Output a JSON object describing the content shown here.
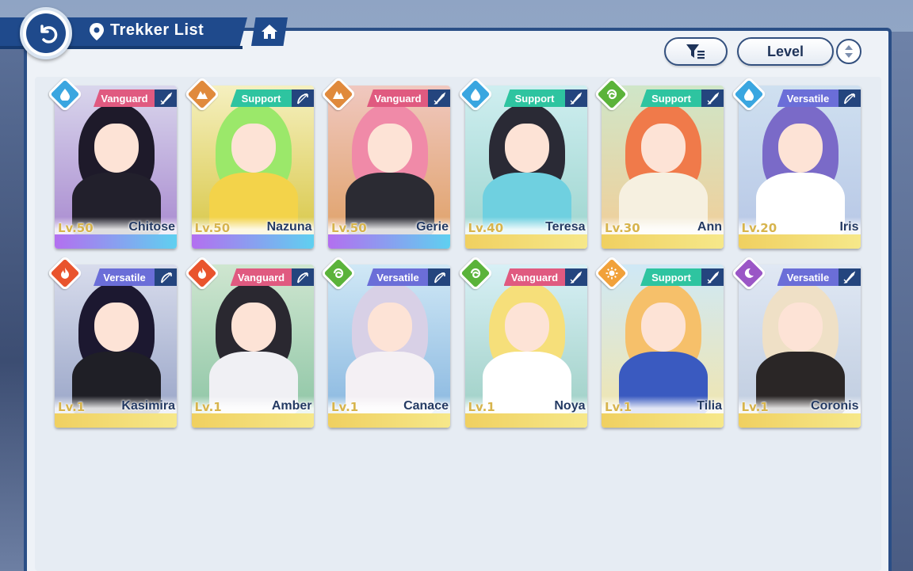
{
  "header": {
    "title": "Trekker List"
  },
  "toolbar": {
    "sort_label": "Level"
  },
  "colors": {
    "primary": "#1f4a8c",
    "vanguard": "#e05a80",
    "support": "#2ec4a0",
    "versatile": "#6b6ed8"
  },
  "trekkers": [
    {
      "name": "Chitose",
      "level": "Lv.50",
      "role": "Vanguard",
      "element": "water-icon",
      "weapon": "sword-icon"
    },
    {
      "name": "Nazuna",
      "level": "Lv.50",
      "role": "Support",
      "element": "earth-icon",
      "weapon": "bow-icon"
    },
    {
      "name": "Gerie",
      "level": "Lv.50",
      "role": "Vanguard",
      "element": "earth-icon",
      "weapon": "sword-icon"
    },
    {
      "name": "Teresa",
      "level": "Lv.40",
      "role": "Support",
      "element": "water-icon",
      "weapon": "sword-icon"
    },
    {
      "name": "Ann",
      "level": "Lv.30",
      "role": "Support",
      "element": "wind-icon",
      "weapon": "sword-icon"
    },
    {
      "name": "Iris",
      "level": "Lv.20",
      "role": "Versatile",
      "element": "water-icon",
      "weapon": "bow-icon"
    },
    {
      "name": "Kasimira",
      "level": "Lv.1",
      "role": "Versatile",
      "element": "fire-icon",
      "weapon": "bow-icon"
    },
    {
      "name": "Amber",
      "level": "Lv.1",
      "role": "Vanguard",
      "element": "fire-icon",
      "weapon": "bow-icon"
    },
    {
      "name": "Canace",
      "level": "Lv.1",
      "role": "Versatile",
      "element": "wind-icon",
      "weapon": "bow-icon"
    },
    {
      "name": "Noya",
      "level": "Lv.1",
      "role": "Vanguard",
      "element": "wind-icon",
      "weapon": "sword-icon"
    },
    {
      "name": "Tilia",
      "level": "Lv.1",
      "role": "Support",
      "element": "light-icon",
      "weapon": "sword-icon"
    },
    {
      "name": "Coronis",
      "level": "Lv.1",
      "role": "Versatile",
      "element": "dark-icon",
      "weapon": "sword-icon"
    }
  ]
}
